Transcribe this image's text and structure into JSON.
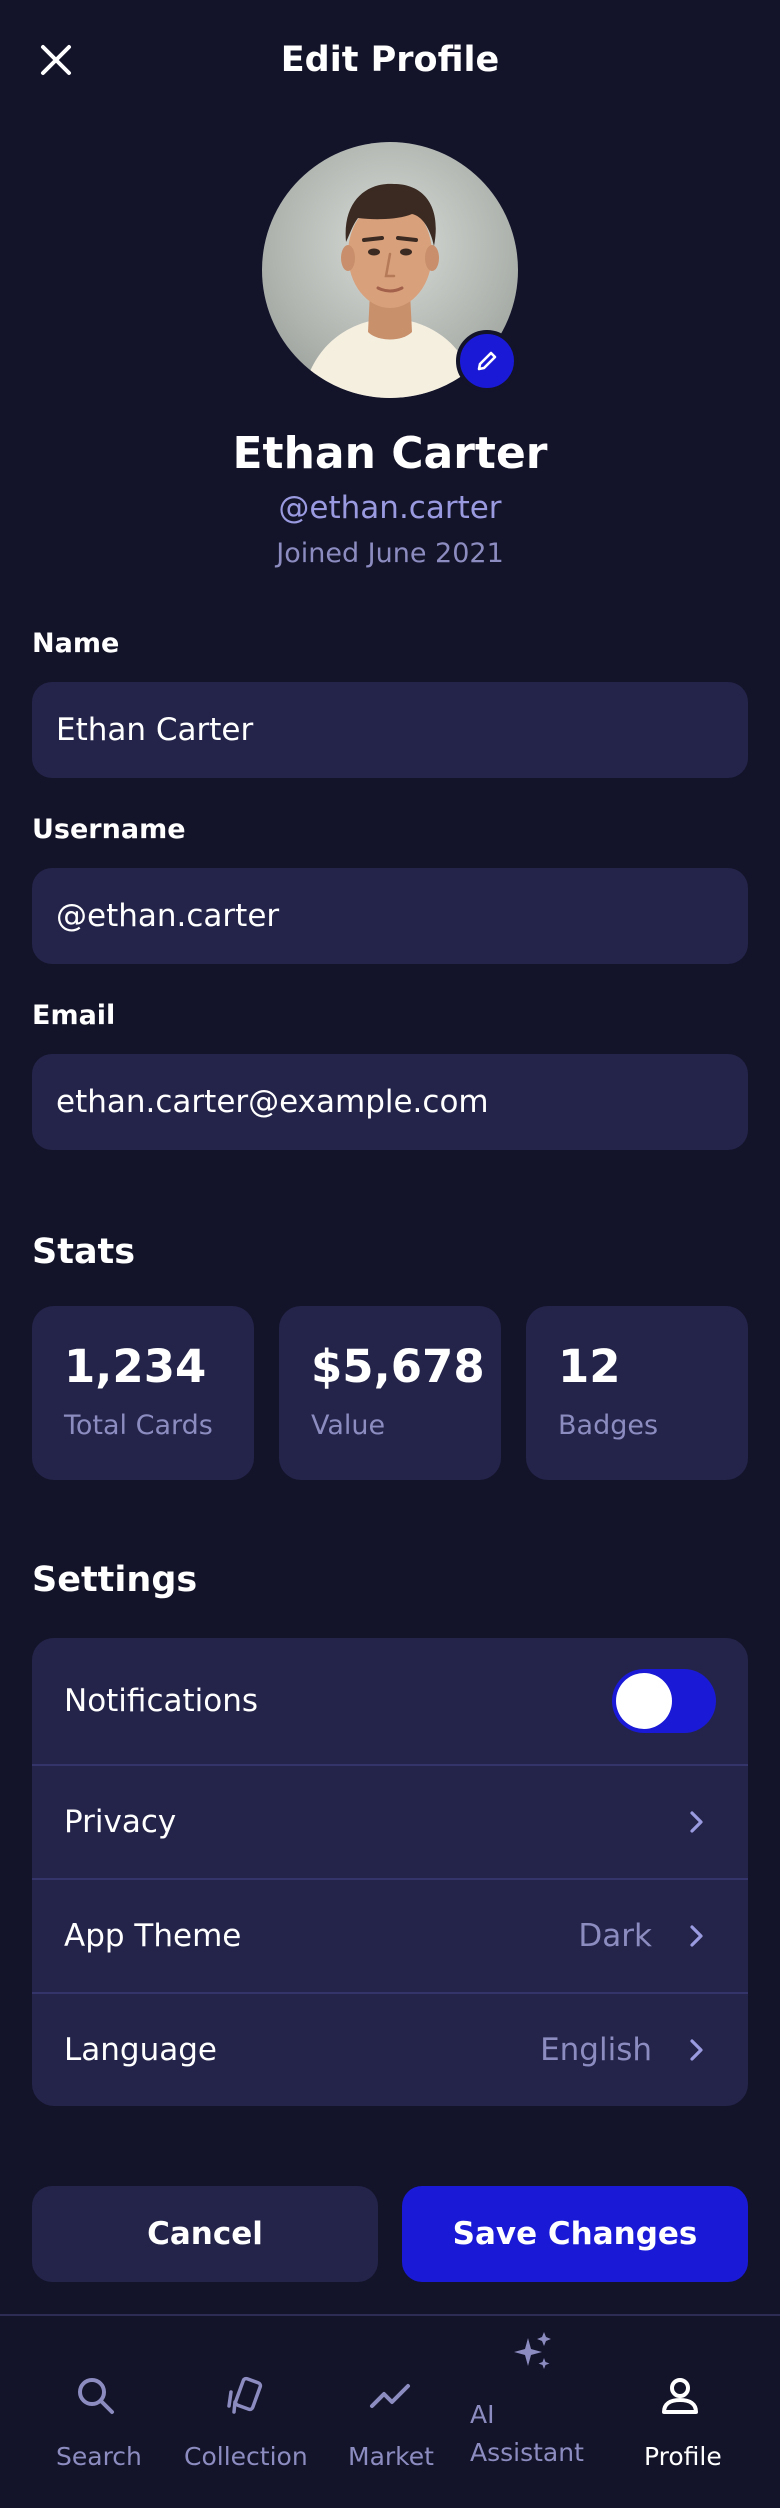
{
  "header": {
    "title": "Edit Profile"
  },
  "profile": {
    "name": "Ethan Carter",
    "handle": "@ethan.carter",
    "joined": "Joined June 2021"
  },
  "fields": {
    "name": {
      "label": "Name",
      "value": "Ethan Carter"
    },
    "username": {
      "label": "Username",
      "value": "@ethan.carter"
    },
    "email": {
      "label": "Email",
      "value": "ethan.carter@example.com"
    }
  },
  "stats": {
    "title": "Stats",
    "items": [
      {
        "value": "1,234",
        "label": "Total Cards"
      },
      {
        "value": "$5,678",
        "label": "Value"
      },
      {
        "value": "12",
        "label": "Badges"
      }
    ]
  },
  "settings": {
    "title": "Settings",
    "notifications": {
      "label": "Notifications",
      "enabled": true
    },
    "privacy": {
      "label": "Privacy"
    },
    "theme": {
      "label": "App Theme",
      "value": "Dark"
    },
    "language": {
      "label": "Language",
      "value": "English"
    }
  },
  "actions": {
    "cancel": "Cancel",
    "save": "Save Changes"
  },
  "nav": {
    "search": "Search",
    "collection": "Collection",
    "market": "Market",
    "assistant": "AI Assistant",
    "profile": "Profile"
  },
  "colors": {
    "background": "#13132a",
    "surface": "#24244a",
    "accent": "#1a1ad6",
    "muted_text": "#8c8cc0",
    "handle_text": "#9a9ae0"
  }
}
